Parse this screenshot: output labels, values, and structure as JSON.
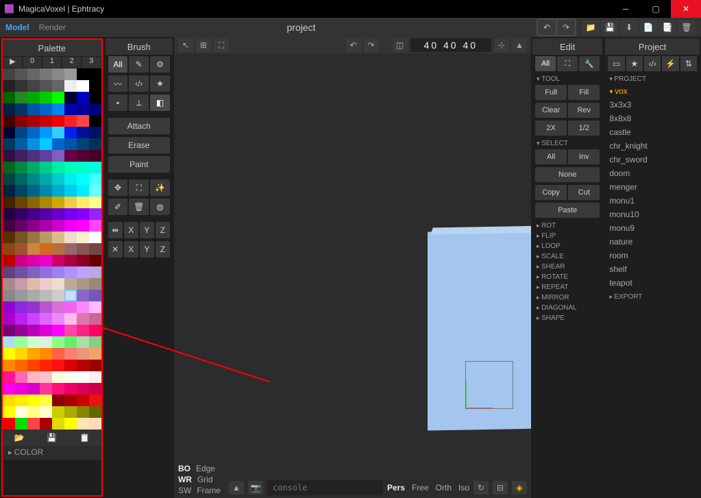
{
  "window": {
    "title": "MagicaVoxel | Ephtracy"
  },
  "tabs": {
    "model": "Model",
    "render": "Render"
  },
  "project_name": "project",
  "palette": {
    "title": "Palette",
    "tabs": [
      "▶",
      "0",
      "1",
      "2",
      "3"
    ],
    "footer_color": "COLOR"
  },
  "brush": {
    "title": "Brush",
    "all": "All",
    "attach": "Attach",
    "erase": "Erase",
    "paint": "Paint",
    "axes": [
      "X",
      "Y",
      "Z"
    ]
  },
  "viewport": {
    "dims": "40  40  40",
    "bo": "BO",
    "wr": "WR",
    "sw": "SW",
    "edge": "Edge",
    "grid": "Grid",
    "frame": "Frame",
    "console_placeholder": "console",
    "cams": [
      "Pers",
      "Free",
      "Orth",
      "Iso"
    ]
  },
  "edit": {
    "title": "Edit",
    "all": "All",
    "tool": "TOOL",
    "full": "Full",
    "fill": "Fill",
    "clear": "Clear",
    "rev": "Rev",
    "x2": "2X",
    "half": "1/2",
    "select": "SELECT",
    "sel_all": "All",
    "inv": "Inv",
    "none": "None",
    "copy": "Copy",
    "cut": "Cut",
    "paste": "Paste",
    "sections": [
      "ROT",
      "FLIP",
      "LOOP",
      "SCALE",
      "SHEAR",
      "ROTATE",
      "REPEAT",
      "MIRROR",
      "DIAGONAL",
      "SHAPE"
    ]
  },
  "project": {
    "title": "Project",
    "header": "PROJECT",
    "items": [
      "vox",
      "3x3x3",
      "8x8x8",
      "castle",
      "chr_knight",
      "chr_sword",
      "doom",
      "menger",
      "monu1",
      "monu10",
      "monu9",
      "nature",
      "room",
      "shelf",
      "teapot"
    ],
    "export": "EXPORT"
  },
  "palette_colors": [
    "#444",
    "#555",
    "#666",
    "#777",
    "#888",
    "#999",
    "#000",
    "#000",
    "#222",
    "#333",
    "#444",
    "#555",
    "#666",
    "#eee",
    "#fff",
    "#000",
    "#006400",
    "#228b22",
    "#0a0",
    "#0c0",
    "#0f0",
    "#003",
    "#00b",
    "#000",
    "#002244",
    "#003366",
    "#0055aa",
    "#06c",
    "#08e",
    "#00a",
    "#009",
    "#007",
    "#400",
    "#800",
    "#a00",
    "#c00",
    "#e00",
    "#f22",
    "#f44",
    "#000",
    "#003",
    "#004488",
    "#0066cc",
    "#09f",
    "#3cf",
    "#02e",
    "#019",
    "#016",
    "#013a5e",
    "#025ea0",
    "#0591e0",
    "#0cf",
    "#06c",
    "#05a",
    "#047",
    "#035",
    "#301040",
    "#402060",
    "#503080",
    "#6040a0",
    "#7f5fbf",
    "#604",
    "#503",
    "#402",
    "#062",
    "#084",
    "#0a6",
    "#0c8",
    "#0ea",
    "#0fb",
    "#0fc",
    "#0fd",
    "#044",
    "#066",
    "#088",
    "#0aa",
    "#0cc",
    "#0ee",
    "#0ff",
    "#4ff",
    "#024",
    "#046",
    "#068",
    "#08a",
    "#0ac",
    "#0ce",
    "#0ef",
    "#6ff",
    "#420",
    "#640",
    "#860",
    "#a80",
    "#ca0",
    "#ec4",
    "#fe6",
    "#ff8",
    "#204",
    "#306",
    "#408",
    "#50a",
    "#60c",
    "#70e",
    "#80f",
    "#92f",
    "#404",
    "#606",
    "#808",
    "#a0a",
    "#c0c",
    "#e0e",
    "#f0f",
    "#f4f",
    "#530",
    "#752",
    "#974",
    "#b96",
    "#db8",
    "#edc",
    "#fec",
    "#fff",
    "#8b4513",
    "#a0522d",
    "#cd853f",
    "#d2691e",
    "#b76e3b",
    "#966",
    "#855",
    "#744",
    "#b00",
    "#c08",
    "#d0a",
    "#e0c",
    "#c06",
    "#a04",
    "#802",
    "#600",
    "#604080",
    "#7050a0",
    "#8060c0",
    "#9070e0",
    "#a080f0",
    "#b090ff",
    "#c0a0ff",
    "#b8a8e0",
    "#a88",
    "#c9a",
    "#dba",
    "#ecc",
    "#edc",
    "#ba9",
    "#a98",
    "#987",
    "#888",
    "#999",
    "#aaa",
    "#bbb",
    "#ccc",
    "#ddd",
    "#86c",
    "#75b",
    "#9400d3",
    "#8a2be2",
    "#9932cc",
    "#ba55d3",
    "#da70d6",
    "#e6e",
    "#f8f",
    "#fbf",
    "#a0c",
    "#b2e",
    "#c4f",
    "#d6f",
    "#e8f",
    "#fbe",
    "#d7a",
    "#c69",
    "#707",
    "#909",
    "#b0b",
    "#d0d",
    "#f0f",
    "#f4a",
    "#f28",
    "#f06",
    "#ade",
    "#9f9",
    "#cfc",
    "#ded",
    "#8f8",
    "#6e6",
    "#ada",
    "#8c8",
    "#ff0",
    "#ffd700",
    "#ffa500",
    "#ff8c00",
    "#ff6347",
    "#fa8072",
    "#e9967a",
    "#f4a460",
    "#f80",
    "#f60",
    "#f40",
    "#f20",
    "#f11",
    "#d00",
    "#b00",
    "#900",
    "#ff1493",
    "#ff69b4",
    "#ffb6c1",
    "#ffc0cb",
    "#ffd",
    "#ffe",
    "#fff",
    "#fee",
    "#f0e",
    "#e0d",
    "#d0c",
    "#f39",
    "#f17",
    "#e06",
    "#d05",
    "#c04",
    "#fd0",
    "#fe0",
    "#ff0",
    "#ff4",
    "#8b0000",
    "#a00",
    "#c00",
    "#e11",
    "#ff0",
    "#ffd",
    "#ff8",
    "#ffc",
    "#cc0",
    "#aa0",
    "#880",
    "#660",
    "#e00",
    "#0d0",
    "#f44",
    "#a00",
    "#dd0",
    "#ff0",
    "#ffe4b5",
    "#ffdab9"
  ]
}
